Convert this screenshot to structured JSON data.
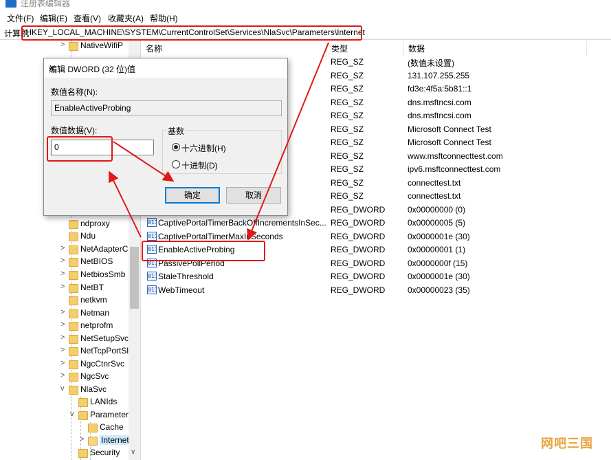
{
  "window": {
    "title": "注册表编辑器"
  },
  "menu": [
    "文件(F)",
    "编辑(E)",
    "查看(V)",
    "收藏夹(A)",
    "帮助(H)"
  ],
  "address": {
    "label": "计算机",
    "path": "\\HKEY_LOCAL_MACHINE\\SYSTEM\\CurrentControlSet\\Services\\NlaSvc\\Parameters\\Internet"
  },
  "tree": [
    {
      "label": "NativeWifiP",
      "chev": ">"
    },
    {
      "label": "ndproxy",
      "chev": ""
    },
    {
      "label": "Ndu",
      "chev": ""
    },
    {
      "label": "NetAdapterC",
      "chev": ">"
    },
    {
      "label": "NetBIOS",
      "chev": ">"
    },
    {
      "label": "NetbiosSmb",
      "chev": ">"
    },
    {
      "label": "NetBT",
      "chev": ">"
    },
    {
      "label": "netkvm",
      "chev": ""
    },
    {
      "label": "Netman",
      "chev": ">"
    },
    {
      "label": "netprofm",
      "chev": ">"
    },
    {
      "label": "NetSetupSvc",
      "chev": ">"
    },
    {
      "label": "NetTcpPortSl",
      "chev": ">"
    },
    {
      "label": "NgcCtnrSvc",
      "chev": ">"
    },
    {
      "label": "NgcSvc",
      "chev": ">"
    },
    {
      "label": "NlaSvc",
      "chev": "v"
    },
    {
      "label": "LANIds",
      "chev": ""
    },
    {
      "label": "Parameter",
      "chev": "v"
    },
    {
      "label": "Cache",
      "chev": ""
    },
    {
      "label": "Internet",
      "chev": ">"
    },
    {
      "label": "Security",
      "chev": ""
    }
  ],
  "columns": {
    "name": "名称",
    "type": "类型",
    "data": "数据"
  },
  "rows": [
    {
      "name": "",
      "type": "REG_SZ",
      "data": "(数值未设置)"
    },
    {
      "name": "",
      "type": "REG_SZ",
      "data": "131.107.255.255"
    },
    {
      "name": "",
      "type": "REG_SZ",
      "data": "fd3e:4f5a:5b81::1"
    },
    {
      "name": "",
      "type": "REG_SZ",
      "data": "dns.msftncsi.com"
    },
    {
      "name": "",
      "type": "REG_SZ",
      "data": "dns.msftncsi.com"
    },
    {
      "name": "",
      "type": "REG_SZ",
      "data": "Microsoft Connect Test"
    },
    {
      "name": "",
      "type": "REG_SZ",
      "data": "Microsoft Connect Test"
    },
    {
      "name": "",
      "type": "REG_SZ",
      "data": "www.msftconnecttest.com"
    },
    {
      "name": "",
      "type": "REG_SZ",
      "data": "ipv6.msftconnecttest.com"
    },
    {
      "name": "",
      "type": "REG_SZ",
      "data": "connecttest.txt"
    },
    {
      "name": "",
      "type": "REG_SZ",
      "data": "connecttest.txt"
    },
    {
      "name": "",
      "type": "REG_DWORD",
      "data": "0x00000000 (0)"
    },
    {
      "name": "CaptivePortalTimerBackOffIncrementsInSec...",
      "type": "REG_DWORD",
      "data": "0x00000005 (5)"
    },
    {
      "name": "CaptivePortalTimerMaxInSeconds",
      "type": "REG_DWORD",
      "data": "0x0000001e (30)"
    },
    {
      "name": "EnableActiveProbing",
      "type": "REG_DWORD",
      "data": "0x00000001 (1)"
    },
    {
      "name": "PassivePollPeriod",
      "type": "REG_DWORD",
      "data": "0x0000000f (15)"
    },
    {
      "name": "StaleThreshold",
      "type": "REG_DWORD",
      "data": "0x0000001e (30)"
    },
    {
      "name": "WebTimeout",
      "type": "REG_DWORD",
      "data": "0x00000023 (35)"
    }
  ],
  "dialog": {
    "title": "编辑 DWORD (32 位)值",
    "close": "✕",
    "name_label": "数值名称(N):",
    "name_value": "EnableActiveProbing",
    "data_label": "数值数据(V):",
    "data_value": "0",
    "base_label": "基数",
    "hex_label": "十六进制(H)",
    "dec_label": "十进制(D)",
    "ok": "确定",
    "cancel": "取消"
  },
  "watermark": "网吧三国",
  "colors": {
    "highlight": "#e01818",
    "selection": "#cce8ff",
    "folder": "#f5cd6a"
  }
}
